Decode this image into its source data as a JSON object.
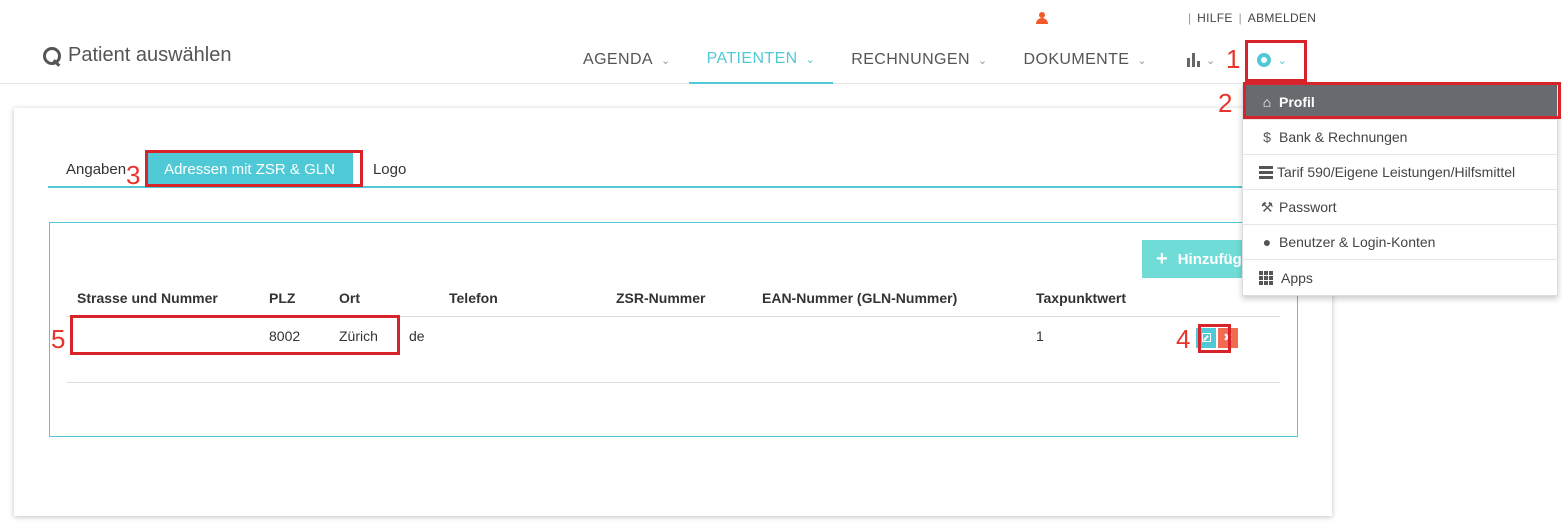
{
  "util_bar": {
    "user_name": "",
    "help": "HILFE",
    "logout": "ABMELDEN"
  },
  "header": {
    "patient_select": "Patient auswählen",
    "nav": [
      {
        "label": "AGENDA",
        "active": false
      },
      {
        "label": "PATIENTEN",
        "active": true
      },
      {
        "label": "RECHNUNGEN",
        "active": false
      },
      {
        "label": "DOKUMENTE",
        "active": false
      }
    ],
    "stats_icon": "bar-chart-icon",
    "settings_icon": "gear-icon"
  },
  "settings_menu": {
    "items": [
      {
        "label": "Profil",
        "icon": "home-icon",
        "active": true
      },
      {
        "label": "Bank & Rechnungen",
        "icon": "dollar-icon",
        "active": false
      },
      {
        "label": "Tarif 590/Eigene Leistungen/Hilfsmittel",
        "icon": "list-icon",
        "active": false
      },
      {
        "label": "Passwort",
        "icon": "wrench-icon",
        "active": false
      },
      {
        "label": "Benutzer & Login-Konten",
        "icon": "user-icon",
        "active": false
      },
      {
        "label": "Apps",
        "icon": "grid-icon",
        "active": false
      }
    ]
  },
  "tabs": [
    {
      "label": "Angaben",
      "active": false
    },
    {
      "label": "Adressen mit ZSR & GLN",
      "active": true
    },
    {
      "label": "Logo",
      "active": false
    }
  ],
  "panel": {
    "add_button": "Hinzufügen",
    "columns": [
      "Strasse und Nummer",
      "PLZ",
      "Ort",
      "Telefon",
      "ZSR-Nummer",
      "EAN-Nummer (GLN-Nummer)",
      "Taxpunktwert"
    ],
    "rows": [
      {
        "street": "",
        "plz": "8002",
        "ort": "Zürich",
        "telefon": "de",
        "zsr": "",
        "ean": "",
        "taxpunktwert": "1"
      }
    ]
  },
  "annotations": {
    "n1": "1",
    "n2": "2",
    "n3": "3",
    "n4": "4",
    "n5": "5",
    "color": "#d8232a"
  },
  "colors": {
    "accent": "#4fc9d5",
    "menu_active": "#676b6f",
    "delete": "#f06b4f",
    "add_button": "#6fdcd8"
  }
}
